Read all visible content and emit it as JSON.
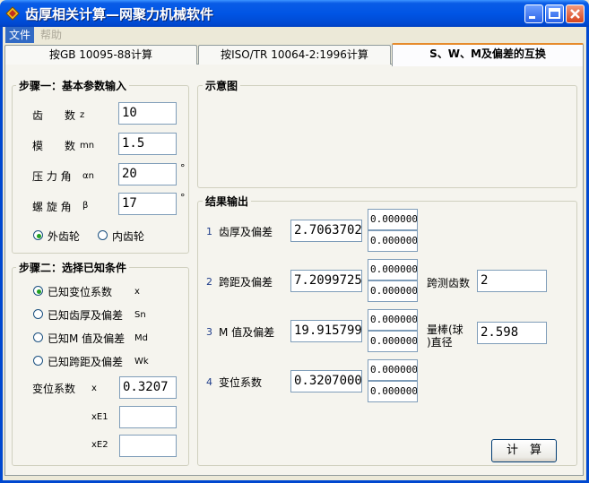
{
  "window": {
    "title": "齿厚相关计算—网聚力机械软件",
    "colors": {
      "titlebar": "#0055e5",
      "tab_highlight": "#e68b2c",
      "radio_dot": "#21a121"
    },
    "icons": [
      "app-icon",
      "minimize-icon",
      "maximize-icon",
      "close-icon"
    ]
  },
  "menu": [
    "文件",
    "帮助"
  ],
  "tabs": [
    "按GB 10095-88计算",
    "按ISO/TR 10064-2:1996计算",
    "S、W、M及偏差的互换"
  ],
  "step1": {
    "title": "步骤一：基本参数输入",
    "teeth": {
      "label": "齿　　数",
      "sym": "z",
      "value": "10"
    },
    "module": {
      "label": "模　　数",
      "sym": "mn",
      "value": "1.5"
    },
    "pressure_angle": {
      "label": "压 力 角",
      "sym": "αn",
      "value": "20",
      "unit": "°"
    },
    "helix_angle": {
      "label": "螺 旋 角",
      "sym": "β",
      "value": "17",
      "unit": "°"
    },
    "gear_external": "外齿轮",
    "gear_internal": "内齿轮"
  },
  "step2": {
    "title": "步骤二：选择已知条件",
    "options": [
      {
        "label": "已知变位系数",
        "sym": "x"
      },
      {
        "label": "已知齿厚及偏差",
        "sym": "Sn"
      },
      {
        "label": "已知M 值及偏差",
        "sym": "Md"
      },
      {
        "label": "已知跨距及偏差",
        "sym": "Wk"
      }
    ],
    "shift": {
      "label": "变位系数",
      "sym": "x",
      "value": "0.3207"
    },
    "xe1_label": "xE1",
    "xe1_value": "",
    "xe2_label": "xE2",
    "xe2_value": ""
  },
  "diagram": {
    "title": "示意图"
  },
  "results": {
    "title": "结果输出",
    "rows": [
      {
        "num": "1",
        "label": "齿厚及偏差",
        "value": "2.706370256",
        "dev_upper": "0.000000000",
        "dev_lower": "0.000000000"
      },
      {
        "num": "2",
        "label": "跨距及偏差",
        "value": "7.209972507",
        "dev_upper": "0.000000000",
        "dev_lower": "0.000000000"
      },
      {
        "num": "3",
        "label": "M 值及偏差",
        "value": "19.91579932",
        "dev_upper": "0.000000000",
        "dev_lower": "0.000000000"
      },
      {
        "num": "4",
        "label": "变位系数",
        "value": "0.320700000",
        "dev_upper": "0.000000000",
        "dev_lower": "0.000000000"
      }
    ],
    "span_teeth": {
      "label": "跨测齿数",
      "value": "2"
    },
    "rod_diameter": {
      "label1": "量棒(球",
      "label2": ")直径",
      "value": "2.598"
    },
    "calc_button": "计　算"
  }
}
